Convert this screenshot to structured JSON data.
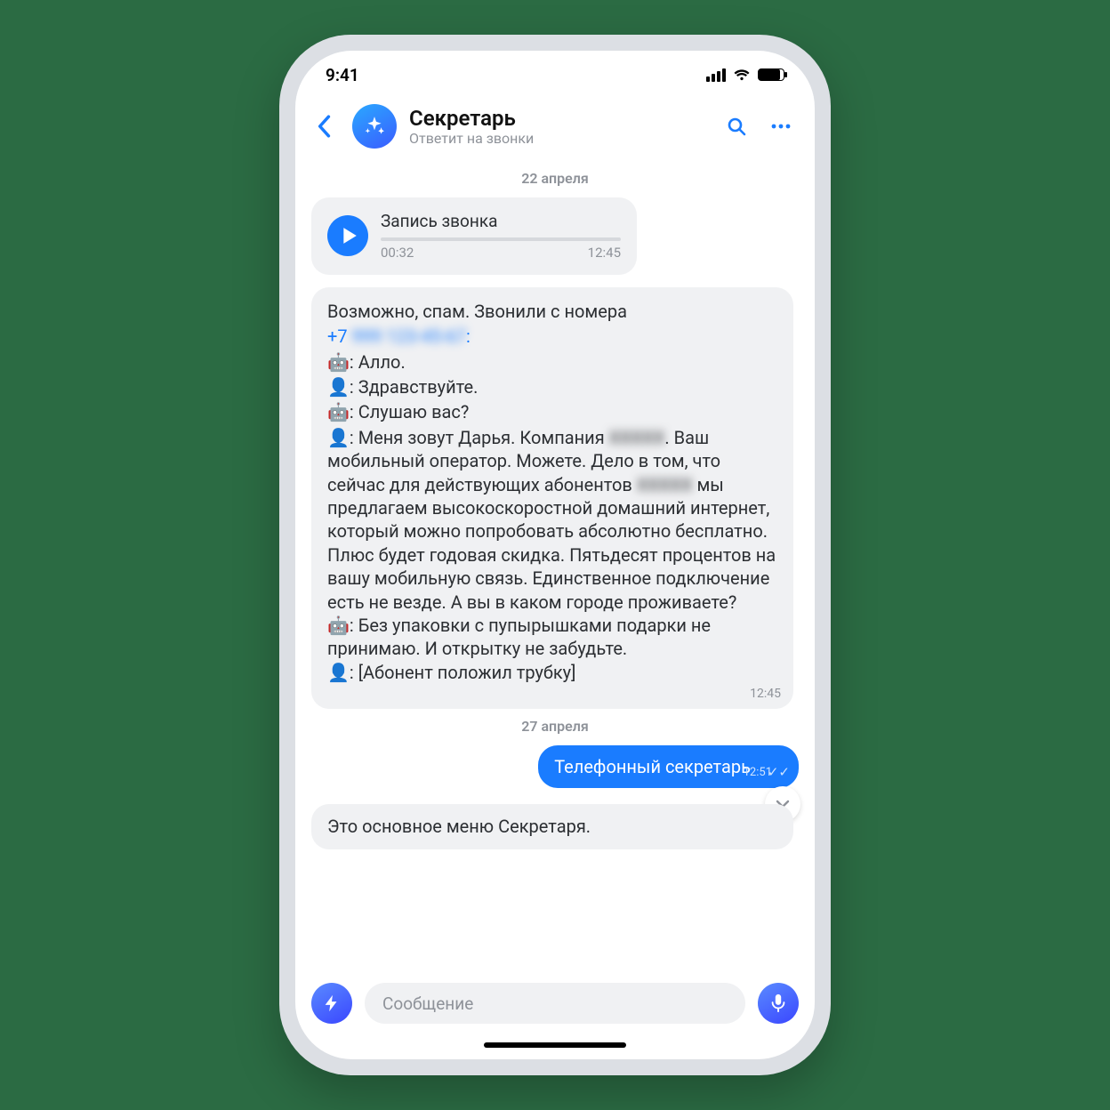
{
  "status": {
    "time": "9:41"
  },
  "header": {
    "title": "Секретарь",
    "subtitle": "Ответит на звонки"
  },
  "dates": {
    "d1": "22 апреля",
    "d2": "27 апреля"
  },
  "voice": {
    "title": "Запись звонка",
    "dur": "00:32",
    "time": "12:45"
  },
  "transcript": {
    "intro": "Возможно, спам. Звонили с номера",
    "phone_prefix": "+7",
    "phone_hidden": "999 123-45-67",
    "l1": "🤖: Алло.",
    "l2": "👤: Здравствуйте.",
    "l3": "🤖: Слушаю вас?",
    "l4a": "👤: Меня зовут Дарья. Компания",
    "l4hidden": "ХХХХХ",
    "l4b": ". Ваш мобильный оператор. Можете. Дело в том, что сейчас для действующих абонентов ",
    "l4hidden2": "ХХХХХ",
    "l4c": " мы предлагаем высокоскоростной домашний интернет, который можно попробовать абсолютно бесплатно. Плюс будет годовая скидка. Пятьдесят процентов на вашу мобильную связь. Единственное подключение есть не везде. А вы в каком городе проживаете?",
    "l5": "🤖: Без упаковки с пупырышками подарки не принимаю. И открытку не забудьте.",
    "l6": "👤: [Абонент положил трубку]",
    "time": "12:45"
  },
  "out": {
    "text": "Телефонный секретарь",
    "time": "12:51"
  },
  "peek": {
    "text": "Это основное меню Секретаря."
  },
  "composer": {
    "placeholder": "Сообщение"
  }
}
